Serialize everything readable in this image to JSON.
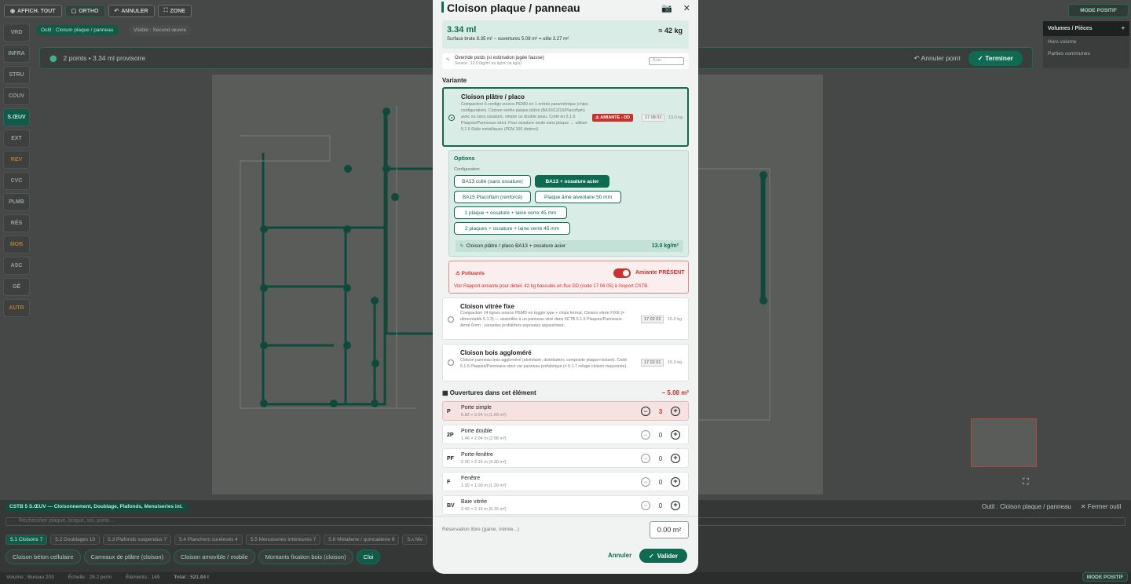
{
  "toolbar": {
    "affich_label": "AFFICH. TOUT",
    "ortho_label": "ORTHO",
    "annuler_label": "ANNULER",
    "zone_label": "ZONE",
    "mode_label": "MODE POSITIF"
  },
  "sidebar": [
    "VRD",
    "INFRA",
    "STRU",
    "COUV",
    "S.ŒUV",
    "EXT",
    "REV",
    "CVC",
    "PLMB",
    "RÉS",
    "MOB",
    "ASC",
    "GÉ",
    "AUTR"
  ],
  "chips": {
    "outil": "Outil : Cloison plaque / panneau",
    "visible": "Visible : Second œuvre"
  },
  "infobar": {
    "points": "2 points • 3.34 ml provisoire",
    "annuler_point": "Annuler point",
    "terminer": "Terminer"
  },
  "right_panel": {
    "title": "Volumes / Pièces",
    "hors_volume": "Hors volume",
    "parties_communes": "Parties communes"
  },
  "modal": {
    "title": "Cloison plaque / panneau",
    "summary_ml": "3.34 ml",
    "summary_kg": "≈ 42 kg",
    "summary_sub": "Surface brute 8.35 m² − ouvertures 5.08 m² = utile 3.27 m²",
    "override_label": "Override poids (si estimation jugée fausse)",
    "override_source": "Source : 13.0 (kg/m² ou kg/ml ou kg/u)",
    "override_placeholder": "Auto",
    "variante_label": "Variante",
    "variants": [
      {
        "title": "Cloison plâtre / placo",
        "desc": "Compaction 6 configs source PEMD en 1 entrée paramétrique (chips configuration). Cloison sèche plaque plâtre (BA10/13/15/Placoflam) avec ou sans ossature, simple ou double peau. Codé en 5.1.5 Plaques/Panneaux strict. Pour ossature seule sans plaque → utiliser 5.1.6 Rails métalliques (PEM 165 distinct).",
        "badge": "⚠ AMIANTE - DD",
        "code": "17 08 02",
        "weight": "13.0 kg"
      },
      {
        "title": "Cloison vitrée fixe",
        "desc": "Compaction 14 lignes source PEMD en toggle type + chips format. Cloison vitrée FIXE (≠ démontable 5.1.3) — assimilée à un panneau vitré dans 5CTB 5.1.5 Plaques/Panneaux. Armé 6mm : variantes profilé/fers exposées séparément.",
        "code": "17 02 02",
        "weight": "15.0 kg"
      },
      {
        "title": "Cloison bois aggloméré",
        "desc": "Cloison panneau bois aggloméré (alvéolaire, distribution, composite plaque+isolant). Codé 5.1.5 Plaques/Panneaux strict car panneau préfabriqué (≠ 5.1.7 refuge cloison maçonnée).",
        "code": "17 02 01",
        "weight": "15.0 kg"
      }
    ],
    "options_title": "Options",
    "config_label": "Configuration",
    "options": [
      "BA13 collé (sans ossature)",
      "BA13 + ossature acier",
      "BA15 Placoflam (renforcé)",
      "Plaque âme alvéolaire 50 mm",
      "1 plaque + ossature + laine verre 45 mm",
      "2 plaques + ossature + laine verre 45 mm"
    ],
    "result_label": "Cloison plâtre / placo BA13 + ossature acier",
    "result_value": "13.0 kg/m²",
    "pollutants_label": "Polluants",
    "amiante_present": "Amiante PRÉSENT",
    "pollutants_desc": "Voir Rapport amiante pour détail. 42 kg basculés en flux DD (code 17 06 05) à l'export CSTB.",
    "ouvertures_title": "Ouvertures dans cet élément",
    "ouvertures_total": "− 5.08 m²",
    "ouvertures": [
      {
        "abbr": "P",
        "name": "Porte simple",
        "dim": "0.83 × 2.04 m (1.69 m²)",
        "qty": "3"
      },
      {
        "abbr": "2P",
        "name": "Porte double",
        "dim": "1.46 × 2.04 m (2.98 m²)",
        "qty": "0"
      },
      {
        "abbr": "PF",
        "name": "Porte-fenêtre",
        "dim": "2.00 × 2.15 m (4.30 m²)",
        "qty": "0"
      },
      {
        "abbr": "F",
        "name": "Fenêtre",
        "dim": "1.20 × 1.00 m (1.20 m²)",
        "qty": "0"
      },
      {
        "abbr": "BV",
        "name": "Baie vitrée",
        "dim": "2.40 × 2.15 m (5.16 m²)",
        "qty": "0"
      }
    ],
    "reservation_label": "Réservation libre (gaine, trémie...)",
    "reservation_value": "0.00 m²",
    "cancel": "Annuler",
    "validate": "Valider"
  },
  "bottom": {
    "category": "CSTB 5 S.ŒUV — Cloisonnement, Doublage, Plafonds, Menuiseries int.",
    "search_placeholder": "Rechercher plaque, brique, sol, porte...",
    "outil": "Outil : Cloison plaque / panneau",
    "fermer": "Fermer outil",
    "tabs": [
      "5.1 Cloisons 7",
      "5.2 Doublages 10",
      "5.3 Plafonds suspendus 7",
      "5.4 Planchers surélevés 4",
      "5.5 Menuiseries intérieures 7",
      "5.6 Métallerie / quincaillerie 8",
      "5.x Me"
    ],
    "pills": [
      "Cloison béton cellulaire",
      "Carreaux de plâtre (cloison)",
      "Cloison amovible / mobile",
      "Montants fixation bois (cloison)",
      "Cloi"
    ],
    "status": [
      "Volume : Bureau 203",
      "Échelle : 28.2 px/m",
      "Éléments : 149",
      "Total : 521.84 t"
    ],
    "mode": "MODE POSITIF"
  }
}
